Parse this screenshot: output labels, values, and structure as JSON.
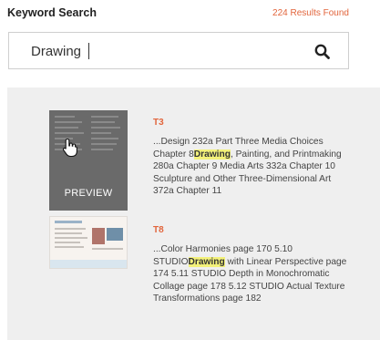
{
  "header": {
    "title": "Keyword Search",
    "results_count": "224 Results Found"
  },
  "search": {
    "value": "Drawing",
    "icon": "search-icon"
  },
  "results": [
    {
      "code": "T3",
      "thumb_label": "PREVIEW",
      "snippet_before": "...Design 232a Part Three Media Choices Chapter 8",
      "highlight": "Drawing",
      "snippet_after": ", Painting, and Printmaking 280a Chapter 9 Media Arts 332a Chapter 10 Sculpture and Other Three-Dimensional Art 372a Chapter 11"
    },
    {
      "code": "T8",
      "snippet_before": "...Color Harmonies page 170 5.10 STUDIO",
      "highlight": "Drawing",
      "snippet_after": " with Linear Perspective page 174 5.11 STUDIO Depth in Monochromatic Collage page 178 5.12 STUDIO Actual Texture Transformations page 182"
    }
  ],
  "colors": {
    "accent": "#e2653c",
    "highlight": "#f3f17a",
    "results_bg": "#efefef"
  }
}
